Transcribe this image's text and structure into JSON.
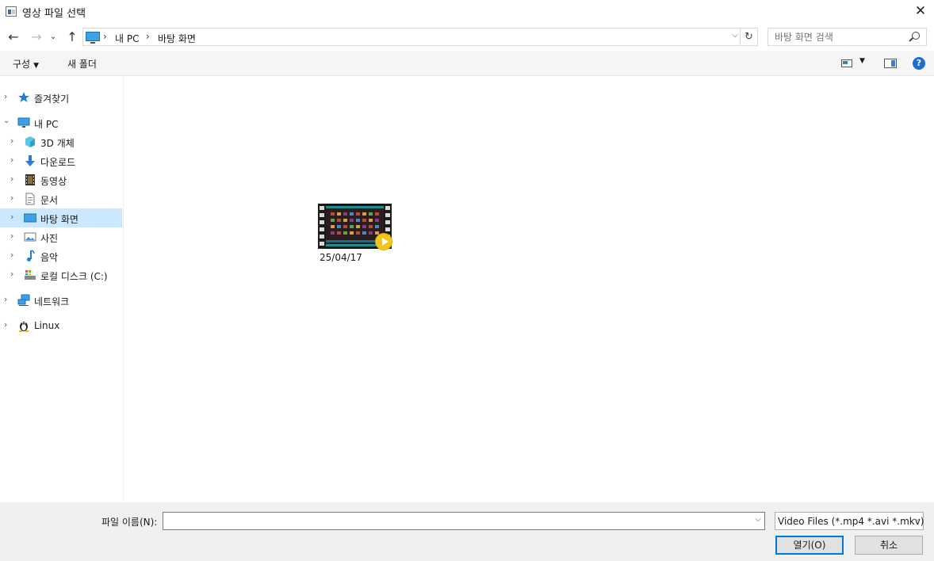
{
  "window": {
    "title": "영상 파일 선택"
  },
  "nav": {
    "breadcrumbs": [
      "내 PC",
      "바탕 화면"
    ],
    "search_placeholder": "바탕 화면 검색"
  },
  "toolbar": {
    "organize_label": "구성",
    "new_folder_label": "새 폴더"
  },
  "sidebar": {
    "items": [
      {
        "label": "즐겨찾기",
        "icon": "star-icon",
        "expanded": false,
        "selected": false
      },
      {
        "label": "내 PC",
        "icon": "computer-icon",
        "expanded": true,
        "selected": false
      },
      {
        "label": "3D 개체",
        "icon": "3d-objects-icon",
        "expanded": false,
        "selected": false
      },
      {
        "label": "다운로드",
        "icon": "download-icon",
        "expanded": false,
        "selected": false
      },
      {
        "label": "동영상",
        "icon": "video-icon",
        "expanded": false,
        "selected": false
      },
      {
        "label": "문서",
        "icon": "document-icon",
        "expanded": false,
        "selected": false
      },
      {
        "label": "바탕 화면",
        "icon": "desktop-icon",
        "expanded": false,
        "selected": true
      },
      {
        "label": "사진",
        "icon": "picture-icon",
        "expanded": false,
        "selected": false
      },
      {
        "label": "음악",
        "icon": "music-icon",
        "expanded": false,
        "selected": false
      },
      {
        "label": "로컬 디스크 (C:)",
        "icon": "drive-icon",
        "expanded": false,
        "selected": false
      },
      {
        "label": "네트워크",
        "icon": "network-icon",
        "expanded": false,
        "selected": false
      },
      {
        "label": "Linux",
        "icon": "linux-icon",
        "expanded": false,
        "selected": false
      }
    ]
  },
  "files": [
    {
      "name": "25/04/17",
      "type": "video",
      "icon": "video-thumbnail"
    }
  ],
  "footer": {
    "filename_label": "파일 이름(N):",
    "filename_value": "",
    "filetype_value": "Video Files (*.mp4 *.avi *.mkv)",
    "open_label": "열기(O)",
    "cancel_label": "취소"
  },
  "colors": {
    "selection": "#cce8ff",
    "accent": "#0078d7"
  }
}
